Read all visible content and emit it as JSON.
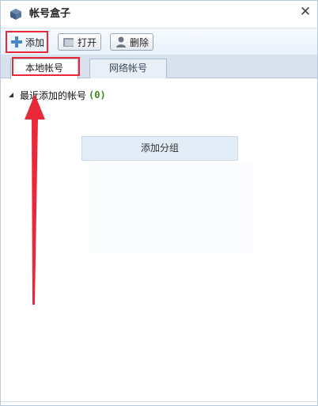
{
  "window": {
    "title": "帐号盒子",
    "close_glyph": "✕"
  },
  "toolbar": {
    "add_label": "添加",
    "open_label": "打开",
    "delete_label": "删除"
  },
  "tabs": [
    {
      "label": "本地帐号",
      "selected": true
    },
    {
      "label": "网络帐号",
      "selected": false
    }
  ],
  "tree": {
    "group_label": "最近添加的帐号",
    "group_count": "(0)"
  },
  "add_group_label": "添加分组",
  "colors": {
    "annotation_red": "#e8293a",
    "accent_blue": "#4a86c5",
    "count_green": "#3b8a1d"
  }
}
